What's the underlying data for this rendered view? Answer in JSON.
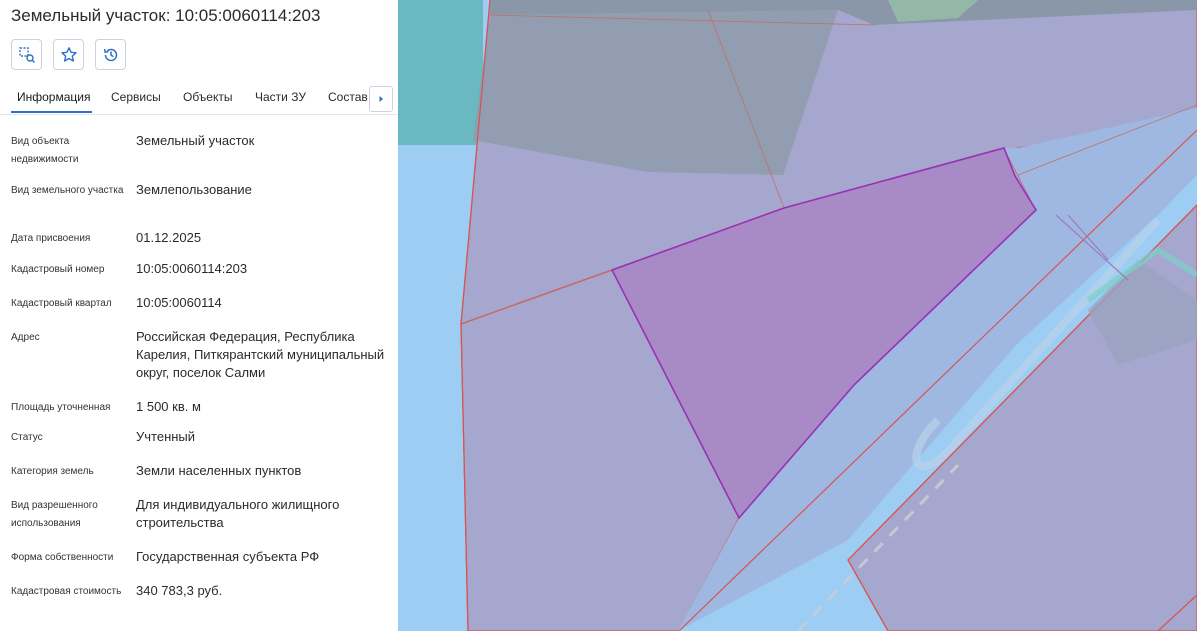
{
  "title": "Земельный участок: 10:05:0060114:203",
  "toolbar": [
    {
      "icon": "map-search-icon"
    },
    {
      "icon": "star-icon"
    },
    {
      "icon": "history-icon"
    }
  ],
  "tabs": [
    {
      "label": "Информация",
      "active": true
    },
    {
      "label": "Сервисы"
    },
    {
      "label": "Объекты"
    },
    {
      "label": "Части ЗУ"
    },
    {
      "label": "Состав"
    }
  ],
  "tab_scroll_icon": "chevron-right-icon",
  "fields": [
    {
      "label": "Вид объекта недвижимости",
      "value": "Земельный участок"
    },
    {
      "label": "Вид земельного участка",
      "value": "Землепользование"
    },
    {
      "label": "Дата присвоения",
      "value": "01.12.2025"
    },
    {
      "label": "Кадастровый номер",
      "value": "10:05:0060114:203"
    },
    {
      "label": "Кадастровый квартал",
      "value": "10:05:0060114"
    },
    {
      "label": "Адрес",
      "value": "Российская Федерация, Республика Карелия, Питкярантский муниципальный округ, поселок Салми"
    },
    {
      "label": "Площадь уточненная",
      "value": "1 500 кв. м"
    },
    {
      "label": "Статус",
      "value": "Учтенный"
    },
    {
      "label": "Категория земель",
      "value": "Земли населенных пунктов"
    },
    {
      "label": "Вид разрешенного использования",
      "value": "Для индивидуального жилищного строительства"
    },
    {
      "label": "Форма собственности",
      "value": "Государственная субъекта РФ"
    },
    {
      "label": "Кадастровая стоимость",
      "value": "340 783,3 руб."
    }
  ],
  "colors": {
    "accent": "#2f6fc4",
    "water": "#9dcdf3",
    "parcel_fill": "#a6a7ce",
    "parcel_border": "#d9534f",
    "selected_parcel_fill": "#a78ac6",
    "selected_parcel_border": "#9a30b5"
  }
}
